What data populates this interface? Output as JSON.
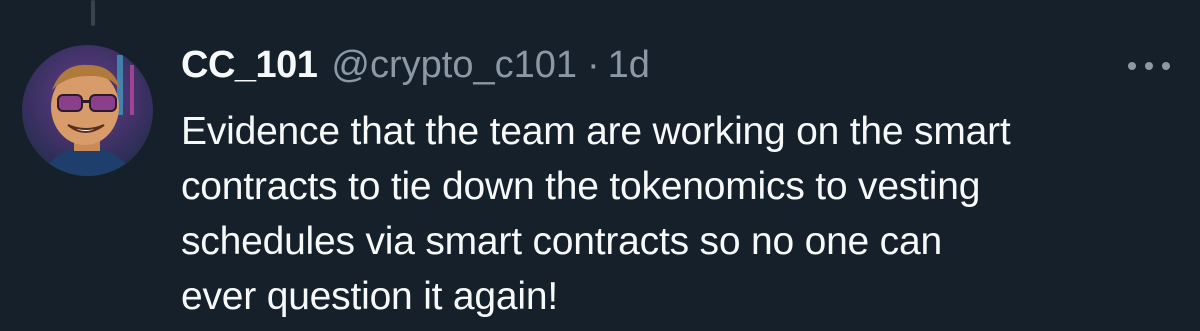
{
  "tweet": {
    "display_name": "CC_101",
    "handle": "@crypto_c101",
    "separator": "·",
    "time": "1d",
    "lines": [
      "Evidence that the team are working on the smart",
      "contracts to tie down the tokenomics to vesting",
      "schedules via smart contracts so no one can",
      "ever question it again!"
    ]
  },
  "icons": {
    "more": "more-options-icon",
    "avatar": "profile-avatar"
  },
  "colors": {
    "background": "#15202b",
    "primary_text": "#f7f9f9",
    "secondary_text": "#8b98a5"
  }
}
